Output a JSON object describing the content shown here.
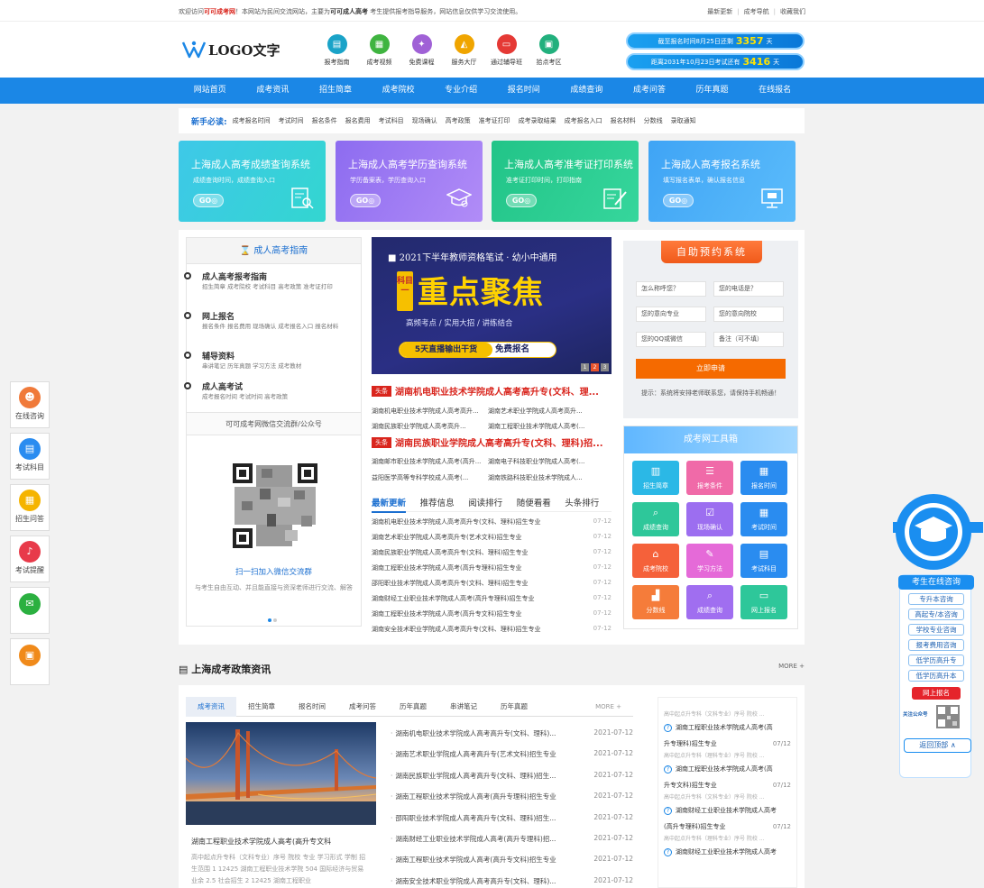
{
  "topbar": {
    "welcome_prefix": "欢迎访问",
    "site_name": "可可成考网",
    "welcome_mid": "！本网站为民间交流网站，主要为",
    "keyword": "可可成人高考",
    "welcome_suffix": " 考生提供报考指导服务，网站信息仅供学习交流使用。",
    "links": [
      "最新更新",
      "成考导航",
      "收藏我们"
    ]
  },
  "header": {
    "logo_text": "LOGO文字",
    "icons": [
      {
        "label": "报考指南",
        "color": "#1aa3c8",
        "icon": "guide-icon"
      },
      {
        "label": "成考视频",
        "color": "#3fb440",
        "icon": "video-icon"
      },
      {
        "label": "免费课程",
        "color": "#a061d6",
        "icon": "course-icon"
      },
      {
        "label": "服务大厅",
        "color": "#f0a500",
        "icon": "service-icon"
      },
      {
        "label": "通过辅导班",
        "color": "#e53935",
        "icon": "class-icon"
      },
      {
        "label": "拾点考区",
        "color": "#22b07d",
        "icon": "area-icon"
      }
    ],
    "count1_prefix": "截至报名时间8月25日还剩",
    "count1_value": "3357",
    "count1_unit": "天",
    "count2_prefix": "距离2031年10月23日考试还有",
    "count2_value": "3416",
    "count2_unit": "天"
  },
  "nav": [
    "网站首页",
    "成考资讯",
    "招生简章",
    "成考院校",
    "专业介绍",
    "报名时间",
    "成绩查询",
    "成考问答",
    "历年真题",
    "在线报名"
  ],
  "newbie": {
    "heading": "新手必读:",
    "items": [
      "成考报名时间",
      "考试时间",
      "报名条件",
      "报名费用",
      "考试科目",
      "现场确认",
      "高考政策",
      "准考证打印",
      "成考录取结果",
      "成考报名入口",
      "报名材料",
      "分数线",
      "录取通知"
    ]
  },
  "cards": [
    {
      "title": "上海成人高考成绩查询系统",
      "sub": "成绩查询时间，成绩查询入口",
      "go": "GO",
      "color1": "#3ec8e8",
      "color2": "#33d6d0"
    },
    {
      "title": "上海成人高考学历查询系统",
      "sub": "学历备案表，学历查询入口",
      "go": "GO",
      "color1": "#8d6cf0",
      "color2": "#b18cf7"
    },
    {
      "title": "上海成人高考准考证打印系统",
      "sub": "准考证打印时间，打印指南",
      "go": "GO",
      "color1": "#22c488",
      "color2": "#36d69c"
    },
    {
      "title": "上海成人高考报名系统",
      "sub": "填写报名表单，确认报名信息",
      "go": "GO",
      "color1": "#3fa4f5",
      "color2": "#5bbcfb"
    }
  ],
  "guide": {
    "title": "成人高考指南",
    "items": [
      {
        "title": "成人高考报考指南",
        "sub": "招生简章  成考院校  考试科目  高考政策  准考证打印"
      },
      {
        "title": "网上报名",
        "sub": "报名条件  报名费用  现场确认  成考报名入口  报名材料"
      },
      {
        "title": "辅导资料",
        "sub": "串讲笔记  历年真题  学习方法  成考教材"
      },
      {
        "title": "成人高考试",
        "sub": "成考报名时间  考试时间  高考政策"
      }
    ],
    "wechat_title": "可可成考网微信交流群/公众号",
    "scan_text": "扫一扫加入微信交流群",
    "desc": "与考生自由互动、并且能直接与资深老师进行交流、解答"
  },
  "promo": {
    "top": "2021下半年教师资格笔试 · 幼小中通用",
    "label": "科目一",
    "big": "重点聚焦",
    "sub": "高频考点 / 实用大招 / 讲练结合",
    "bar_yellow": "5天直播输出干货",
    "bar_white": "免费报名",
    "pages": [
      "1",
      "2",
      "3"
    ]
  },
  "headlines": [
    {
      "badge": "头条",
      "text": "湖南机电职业技术学院成人高考高升专(文科、理...",
      "subs": [
        "湖南机电职业技术学院成人高考高升...",
        "湖南艺术职业学院成人高考高升..."
      ],
      "subs2": [
        "湖南民族职业学院成人高考高升...",
        "湖南工程职业技术学院成人高考(..."
      ]
    },
    {
      "badge": "头条",
      "text": "湖南民族职业学院成人高考高升专(文科、理科)招...",
      "subs": [
        "湖南邮市职业技术学院成人高考(高升...",
        "湖南电子科技职业学院成人高考(..."
      ],
      "subs2": [
        "益阳医学高等专科学校成人高考(...",
        "湖南铁路科技职业技术学院成人..."
      ]
    }
  ],
  "newstabs": [
    "最新更新",
    "推荐信息",
    "阅读排行",
    "随便看看",
    "头条排行"
  ],
  "newslist": [
    {
      "t": "湖南机电职业技术学院成人高考高升专(文科、理科)招生专业",
      "d": "07-12"
    },
    {
      "t": "湖南艺术职业学院成人高考高升专(艺术文科)招生专业",
      "d": "07-12"
    },
    {
      "t": "湖南民族职业学院成人高考高升专(文科、理科)招生专业",
      "d": "07-12"
    },
    {
      "t": "湖南工程职业技术学院成人高考(高升专理科)招生专业",
      "d": "07-12"
    },
    {
      "t": "邵阳职业技术学院成人高考高升专(文科、理科)招生专业",
      "d": "07-12"
    },
    {
      "t": "湖南财经工业职业技术学院成人高考(高升专理科)招生专业",
      "d": "07-12"
    },
    {
      "t": "湖南工程职业技术学院成人高考(高升专文科)招生专业",
      "d": "07-12"
    },
    {
      "t": "湖南安全技术职业学院成人高考高升专(文科、理科)招生专业",
      "d": "07-12"
    }
  ],
  "apply": {
    "title": "自助预约系统",
    "fields": [
      "怎么称呼您？",
      "您的电话是？",
      "您的意向专业",
      "您的意向院校",
      "您的QQ或微信",
      "备注（可不填）"
    ],
    "button": "立即申请",
    "tip": "提示：系统将安排老师联系您，请保持手机畅通！"
  },
  "toolbox": {
    "title": "成考网工具箱",
    "tools": [
      {
        "label": "招生简章",
        "color": "#2bb8e6",
        "icon": "book-icon"
      },
      {
        "label": "报考条件",
        "color": "#f06aa8",
        "icon": "list-icon"
      },
      {
        "label": "报名时间",
        "color": "#2a8cf0",
        "icon": "calendar-icon"
      },
      {
        "label": "成绩查询",
        "color": "#2ec79a",
        "icon": "search-doc-icon"
      },
      {
        "label": "现场确认",
        "color": "#9c6ef0",
        "icon": "check-icon"
      },
      {
        "label": "考试时间",
        "color": "#2a8cf0",
        "icon": "clock-icon"
      },
      {
        "label": "成考院校",
        "color": "#f5613a",
        "icon": "school-icon"
      },
      {
        "label": "学习方法",
        "color": "#e56ad8",
        "icon": "pen-icon"
      },
      {
        "label": "考试科目",
        "color": "#2a8cf0",
        "icon": "subject-icon"
      },
      {
        "label": "分数线",
        "color": "#f57c3a",
        "icon": "chart-icon"
      },
      {
        "label": "成绩查询",
        "color": "#a06ef0",
        "icon": "query-icon"
      },
      {
        "label": "网上报名",
        "color": "#2ec79a",
        "icon": "monitor-icon"
      }
    ]
  },
  "policy": {
    "title": "上海成考政策资讯",
    "more": "MORE +",
    "tabs": [
      "成考资讯",
      "招生简章",
      "报名时间",
      "成考问答",
      "历年真题",
      "串讲笔记",
      "历年真题"
    ],
    "tabs_more": "MORE +",
    "caption": "湖南工程职业技术学院成人高考(高升专文科",
    "caption_desc": "高中起点升专科（文科专业）序号 院校 专业 学习形式 学制 招生范围 1 12425 湖南工程职业技术学院 504 国际经济与贸易 业余 2.5 社会招生 2 12425 湖南工程职业",
    "list": [
      {
        "t": "湖南机电职业技术学院成人高考高升专(文科、理科)...",
        "d": "2021-07-12"
      },
      {
        "t": "湖南艺术职业学院成人高考高升专(艺术文科)招生专业",
        "d": "2021-07-12"
      },
      {
        "t": "湖南民族职业学院成人高考高升专(文科、理科)招生...",
        "d": "2021-07-12"
      },
      {
        "t": "湖南工程职业技术学院成人高考(高升专理科)招生专业",
        "d": "2021-07-12"
      },
      {
        "t": "邵阳职业技术学院成人高考高升专(文科、理科)招生...",
        "d": "2021-07-12"
      },
      {
        "t": "湖南财经工业职业技术学院成人高考(高升专理科)招...",
        "d": "2021-07-12"
      },
      {
        "t": "湖南工程职业技术学院成人高考(高升专文科)招生专业",
        "d": "2021-07-12"
      },
      {
        "t": "湖南安全技术职业学院成人高考高升专(文科、理科)...",
        "d": "2021-07-12"
      }
    ],
    "qa": [
      {
        "q": "",
        "q2": "",
        "d": "",
        "a": "高中起点升专科（文科专业）序号 院校 ..."
      },
      {
        "q": "湖南工程职业技术学院成人高考(高",
        "q2": "升专理科)招生专业",
        "d": "07/12",
        "a": "高中起点升专科（理科专业）序号 院校 ..."
      },
      {
        "q": "湖南工程职业技术学院成人高考(高",
        "q2": "升专文科)招生专业",
        "d": "07/12",
        "a": "高中起点升专科（文科专业）序号 院校 ..."
      },
      {
        "q": "湖南财经工业职业技术学院成人高考",
        "q2": "(高升专理科)招生专业",
        "d": "07/12",
        "a": "高中起点升专科（理科专业）序号 院校 ..."
      },
      {
        "q": "湖南财经工业职业技术学院成人高考",
        "q2": "",
        "d": "",
        "a": ""
      }
    ]
  },
  "leftfloat": [
    {
      "label": "在线咨询",
      "color": "#f07a3a",
      "icon": "person-icon"
    },
    {
      "label": "考试科目",
      "color": "#2a8cf0",
      "icon": "card-icon"
    },
    {
      "label": "招生问答",
      "color": "#f5b400",
      "icon": "qa-icon"
    },
    {
      "label": "考试提醒",
      "color": "#e83a4a",
      "icon": "bell-icon"
    },
    {
      "label": "",
      "color": "#2bb040",
      "icon": "wechat-icon"
    },
    {
      "label": "",
      "color": "#f08a1a",
      "icon": "print-icon"
    }
  ],
  "rightfloat": {
    "title": "考生在线咨询",
    "items": [
      "专升本咨询",
      "高起专/本咨询",
      "学校专业咨询",
      "报考费用咨询",
      "低学历高升专",
      "低学历高升本"
    ],
    "red": "网上报名",
    "follow": "关注公众号",
    "back": "返回顶部 ∧"
  }
}
